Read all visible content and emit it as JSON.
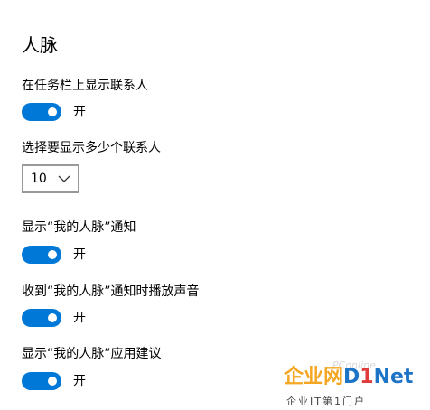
{
  "page": {
    "title": "人脉"
  },
  "settings": {
    "show_contacts_on_taskbar": {
      "label": "在任务栏上显示联系人",
      "state": "开",
      "on": true
    },
    "contacts_count": {
      "label": "选择要显示多少个联系人",
      "value": "10"
    },
    "my_people_notifications": {
      "label": "显示“我的人脉”通知",
      "state": "开",
      "on": true
    },
    "notification_sound": {
      "label": "收到“我的人脉”通知时播放声音",
      "state": "开",
      "on": true
    },
    "app_suggestions": {
      "label": "显示“我的人脉”应用建议",
      "state": "开",
      "on": true
    }
  },
  "colors": {
    "accent": "#0078d7",
    "select_border": "#999999"
  },
  "watermark": {
    "logo_cn": "企业网",
    "logo_d": "D",
    "logo_i": "1",
    "logo_net": "Net",
    "tagline": "企业IT第1门户",
    "faint_text": "PConline"
  },
  "icons": {
    "select_arrow": "chevron-down-icon"
  }
}
